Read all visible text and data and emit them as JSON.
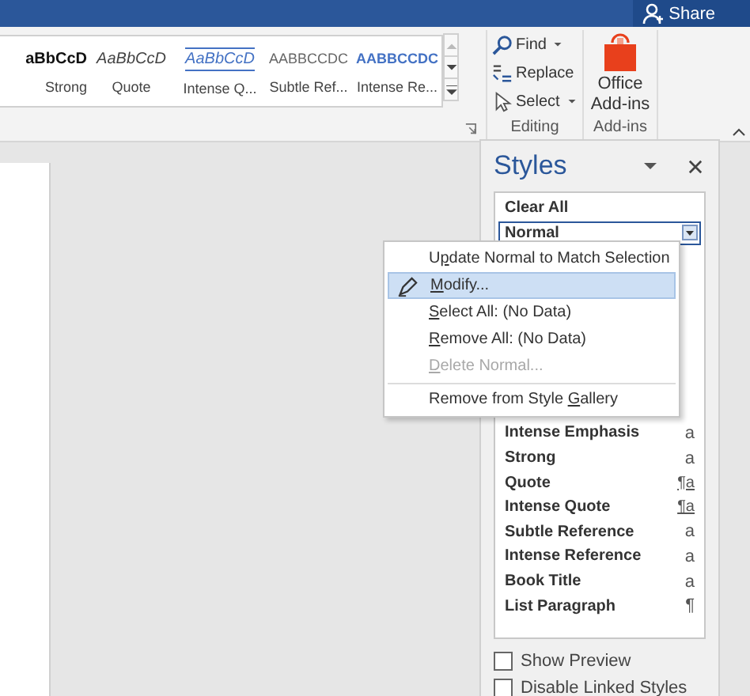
{
  "title_bar": {
    "share_label": "Share"
  },
  "style_gallery": [
    {
      "kind": "strong",
      "preview": "aBbCcD",
      "label": "Strong"
    },
    {
      "kind": "quote",
      "preview": "AaBbCcD",
      "label": "Quote"
    },
    {
      "kind": "intense_quote",
      "preview": "AaBbCcD",
      "label": "Intense Q..."
    },
    {
      "kind": "subtle_reference",
      "preview": "AABBCCDC",
      "label": "Subtle Ref..."
    },
    {
      "kind": "intense_reference",
      "preview": "AABBCCDC",
      "label": "Intense Re..."
    }
  ],
  "editing": {
    "label": "Editing",
    "commands": [
      {
        "kind": "find",
        "label": "Find",
        "dropdown": true
      },
      {
        "kind": "replace",
        "label": "Replace",
        "dropdown": false
      },
      {
        "kind": "select",
        "label": "Select",
        "dropdown": true
      }
    ]
  },
  "addins": {
    "label": "Add-ins",
    "button_lines": [
      "Office",
      "Add-ins"
    ]
  },
  "styles_pane": {
    "title": "Styles",
    "items_above": [
      {
        "name": "Clear All",
        "selected": false
      },
      {
        "name": "Normal",
        "selected": true
      }
    ],
    "items_below": [
      {
        "name": "Intense Emphasis",
        "mark": "a",
        "selected": false
      },
      {
        "name": "Strong",
        "mark": "a",
        "selected": false
      },
      {
        "name": "Quote",
        "mark": "¶a",
        "selected": false
      },
      {
        "name": "Intense Quote",
        "mark": "¶a",
        "selected": false
      },
      {
        "name": "Subtle Reference",
        "mark": "a",
        "selected": false
      },
      {
        "name": "Intense Reference",
        "mark": "a",
        "selected": false
      },
      {
        "name": "Book Title",
        "mark": "a",
        "selected": false
      },
      {
        "name": "List Paragraph",
        "mark": "¶",
        "selected": false
      }
    ],
    "options": [
      {
        "label": "Show Preview",
        "checked": false
      },
      {
        "label": "Disable Linked Styles",
        "checked": false
      }
    ]
  },
  "context_menu": [
    {
      "before": "U",
      "key": "p",
      "after": "date Normal to Match Selection",
      "selected": false,
      "disabled": false,
      "icon": false,
      "separator_before": false
    },
    {
      "key": "M",
      "after": "odify...",
      "selected": true,
      "disabled": false,
      "icon": true,
      "separator_before": false
    },
    {
      "key": "S",
      "after": "elect All: (No Data)",
      "selected": false,
      "disabled": false,
      "icon": false,
      "separator_before": false
    },
    {
      "key": "R",
      "after": "emove All: (No Data)",
      "selected": false,
      "disabled": false,
      "icon": false,
      "separator_before": false
    },
    {
      "key": "D",
      "after": "elete Normal...",
      "selected": false,
      "disabled": true,
      "icon": false,
      "separator_before": false
    },
    {
      "before": "Remove from Style ",
      "key": "G",
      "after": "allery",
      "selected": false,
      "disabled": false,
      "icon": false,
      "separator_before": true
    }
  ]
}
